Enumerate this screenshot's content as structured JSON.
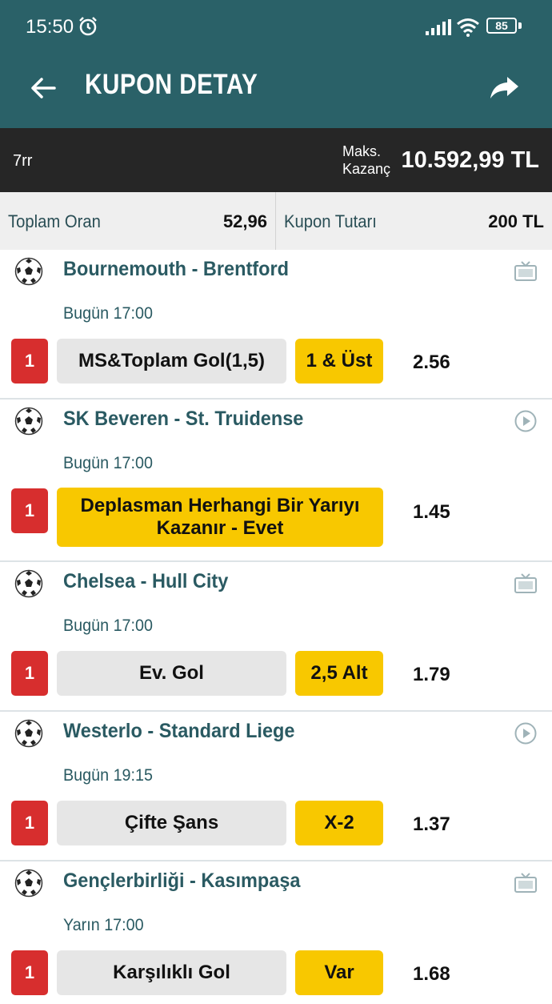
{
  "status_bar": {
    "time": "15:50",
    "battery": "85",
    "icons": [
      "alarm-icon",
      "signal-icon",
      "wifi-icon",
      "battery-icon"
    ]
  },
  "app_bar": {
    "title": "KUPON DETAY",
    "back_icon": "arrow-left-icon",
    "share_icon": "share-icon"
  },
  "summary": {
    "code": "7rr",
    "max_label_1": "Maks.",
    "max_label_2": "Kazanç",
    "max_win": "10.592,99 TL"
  },
  "totals": {
    "total_odds_label": "Toplam Oran",
    "total_odds": "52,96",
    "stake_label": "Kupon Tutarı",
    "stake": "200 TL"
  },
  "colors": {
    "header": "#2a6168",
    "summary_bg": "#262626",
    "accent_yellow": "#f8c800",
    "accent_red": "#d72e2e",
    "team_text": "#2a5a62"
  },
  "matches": [
    {
      "teams": "Bournemouth - Brentford",
      "time": "Bugün 17:00",
      "number": "1",
      "market": "MS&Toplam Gol(1,5)",
      "pick": "1 & Üst",
      "odds": "2.56",
      "side_icon": "tv-icon"
    },
    {
      "teams": "SK Beveren - St. Truidense",
      "time": "Bugün 17:00",
      "number": "1",
      "pick_line1": "Deplasman Herhangi Bir Yarıyı",
      "pick_line2": "Kazanır - Evet",
      "odds": "1.45",
      "side_icon": "play-icon"
    },
    {
      "teams": "Chelsea - Hull City",
      "time": "Bugün 17:00",
      "number": "1",
      "market": "Ev. Gol",
      "pick": "2,5 Alt",
      "odds": "1.79",
      "side_icon": "tv-icon"
    },
    {
      "teams": "Westerlo - Standard Liege",
      "time": "Bugün 19:15",
      "number": "1",
      "market": "Çifte Şans",
      "pick": "X-2",
      "odds": "1.37",
      "side_icon": "play-icon"
    },
    {
      "teams": "Gençlerbirliği - Kasımpaşa",
      "time": "Yarın 17:00",
      "number": "1",
      "market": "Karşılıklı Gol",
      "pick": "Var",
      "odds": "1.68",
      "side_icon": "tv-icon"
    }
  ]
}
